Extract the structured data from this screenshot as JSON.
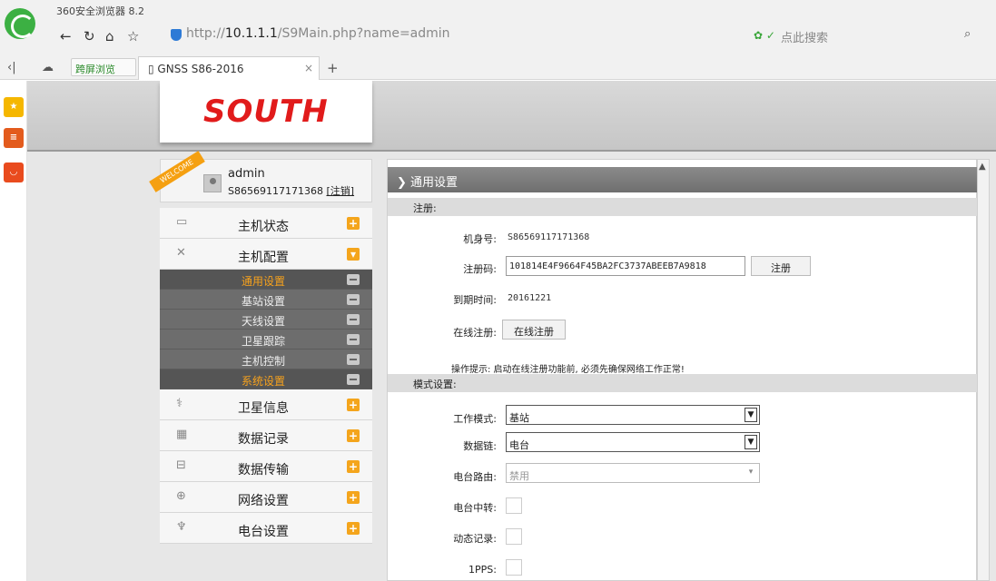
{
  "browser": {
    "app_title": "360安全浏览器 8.2",
    "url_prefix": "http://",
    "url_host": "10.1.1.1",
    "url_path": "/S9Main.php?name=admin",
    "search_placeholder": "点此搜索",
    "split_tab_label": "跨屏浏览",
    "active_tab_label": "GNSS S86-2016"
  },
  "brand": {
    "logo_text": "SOUTH",
    "color": "#e11b1b"
  },
  "user": {
    "welcome": "WELCOME",
    "name": "admin",
    "serial": "S86569117171368",
    "logout_label": "[注销]"
  },
  "menu": {
    "status": "主机状态",
    "config": "主机配置",
    "sub": [
      "通用设置",
      "基站设置",
      "天线设置",
      "卫星跟踪",
      "主机控制",
      "系统设置"
    ],
    "sat_info": "卫星信息",
    "data_record": "数据记录",
    "data_transfer": "数据传输",
    "network": "网络设置",
    "radio": "电台设置"
  },
  "content": {
    "section_title": "通用设置",
    "register_band": "注册:",
    "machine_id_label": "机身号:",
    "machine_id_value": "S86569117171368",
    "reg_code_label": "注册码:",
    "reg_code_value": "101814E4F9664F45BA2FC3737ABEEB7A9818",
    "register_button": "注册",
    "expiry_label": "到期时间:",
    "expiry_value": "20161221",
    "online_reg_label": "在线注册:",
    "online_reg_button": "在线注册",
    "tip": "操作提示: 启动在线注册功能前, 必须先确保网络工作正常!",
    "mode_band": "模式设置:",
    "work_mode_label": "工作模式:",
    "work_mode_value": "基站",
    "datalink_label": "数据链:",
    "datalink_value": "电台",
    "radio_route_label": "电台路由:",
    "radio_route_value": "禁用",
    "radio_relay_label": "电台中转:",
    "dynamic_record_label": "动态记录:",
    "pps_label": "1PPS:"
  },
  "colors": {
    "accent": "#f4a51c",
    "active_sub": "#f7a21d"
  }
}
